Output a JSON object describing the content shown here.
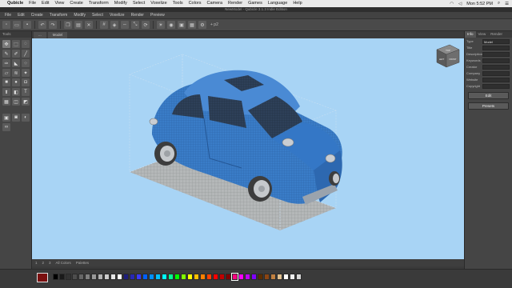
{
  "menubar": {
    "apple": "",
    "items": [
      "Qubicle",
      "File",
      "Edit",
      "View",
      "Create",
      "Transform",
      "Modify",
      "Select",
      "Voxelize",
      "Tools",
      "Colors",
      "Camera",
      "Render",
      "Games",
      "Language",
      "Help"
    ],
    "clock": "Mon 5:52 PM"
  },
  "window": {
    "title": "NewModel - Qubicle 3.1.3 Indie Edition"
  },
  "appmenu": {
    "items": [
      "File",
      "Edit",
      "Create",
      "Transform",
      "Modify",
      "Select",
      "Voxelize",
      "Render",
      "Preview"
    ]
  },
  "toolbar": {
    "zoom_label": "+ p2"
  },
  "tools_panel": {
    "title": "Tools"
  },
  "doc_tabs": [
    "...",
    "Model"
  ],
  "viewport": {
    "bg_color": "#a8d4f5",
    "grid_color": "#b3b3b3",
    "car_color": "#3a7cc7",
    "nav_cube_front": "FRONT",
    "nav_cube_left": "LEFT",
    "nav_cube_top": "TOP"
  },
  "vp_bar": {
    "items": [
      "1",
      "2",
      "3",
      "All Colors",
      "Palettes"
    ]
  },
  "properties": {
    "tabs": [
      "Info",
      "View",
      "Render"
    ],
    "fields": [
      {
        "label": "Type",
        "value": "Model"
      },
      {
        "label": "Title",
        "value": ""
      },
      {
        "label": "Description",
        "value": ""
      },
      {
        "label": "Keywords",
        "value": ""
      },
      {
        "label": "Creator",
        "value": ""
      },
      {
        "label": "Company",
        "value": ""
      },
      {
        "label": "Website",
        "value": ""
      },
      {
        "label": "Copyright",
        "value": ""
      }
    ],
    "edit_button": "Edit",
    "presets_button": "Presets"
  },
  "palette": {
    "current": "#7a0f0f",
    "swatches": [
      "#000000",
      "#1a1a1a",
      "#333333",
      "#4d4d4d",
      "#666666",
      "#808080",
      "#999999",
      "#b3b3b3",
      "#cccccc",
      "#e6e6e6",
      "#ffffff",
      "#1f1f7a",
      "#2828b5",
      "#3a3aff",
      "#0060ff",
      "#0090ff",
      "#00c0ff",
      "#00ffff",
      "#00ff90",
      "#00ff00",
      "#80ff00",
      "#ffff00",
      "#ffc000",
      "#ff8000",
      "#ff4000",
      "#ff0000",
      "#c00000",
      "#800000",
      "#ff0080",
      "#ff00ff",
      "#c000ff",
      "#8000ff",
      "#5a2d00",
      "#8b4513",
      "#c08040",
      "#e0c090",
      "#ffffff",
      "#f0f0f0",
      "#d8d8d8"
    ]
  }
}
